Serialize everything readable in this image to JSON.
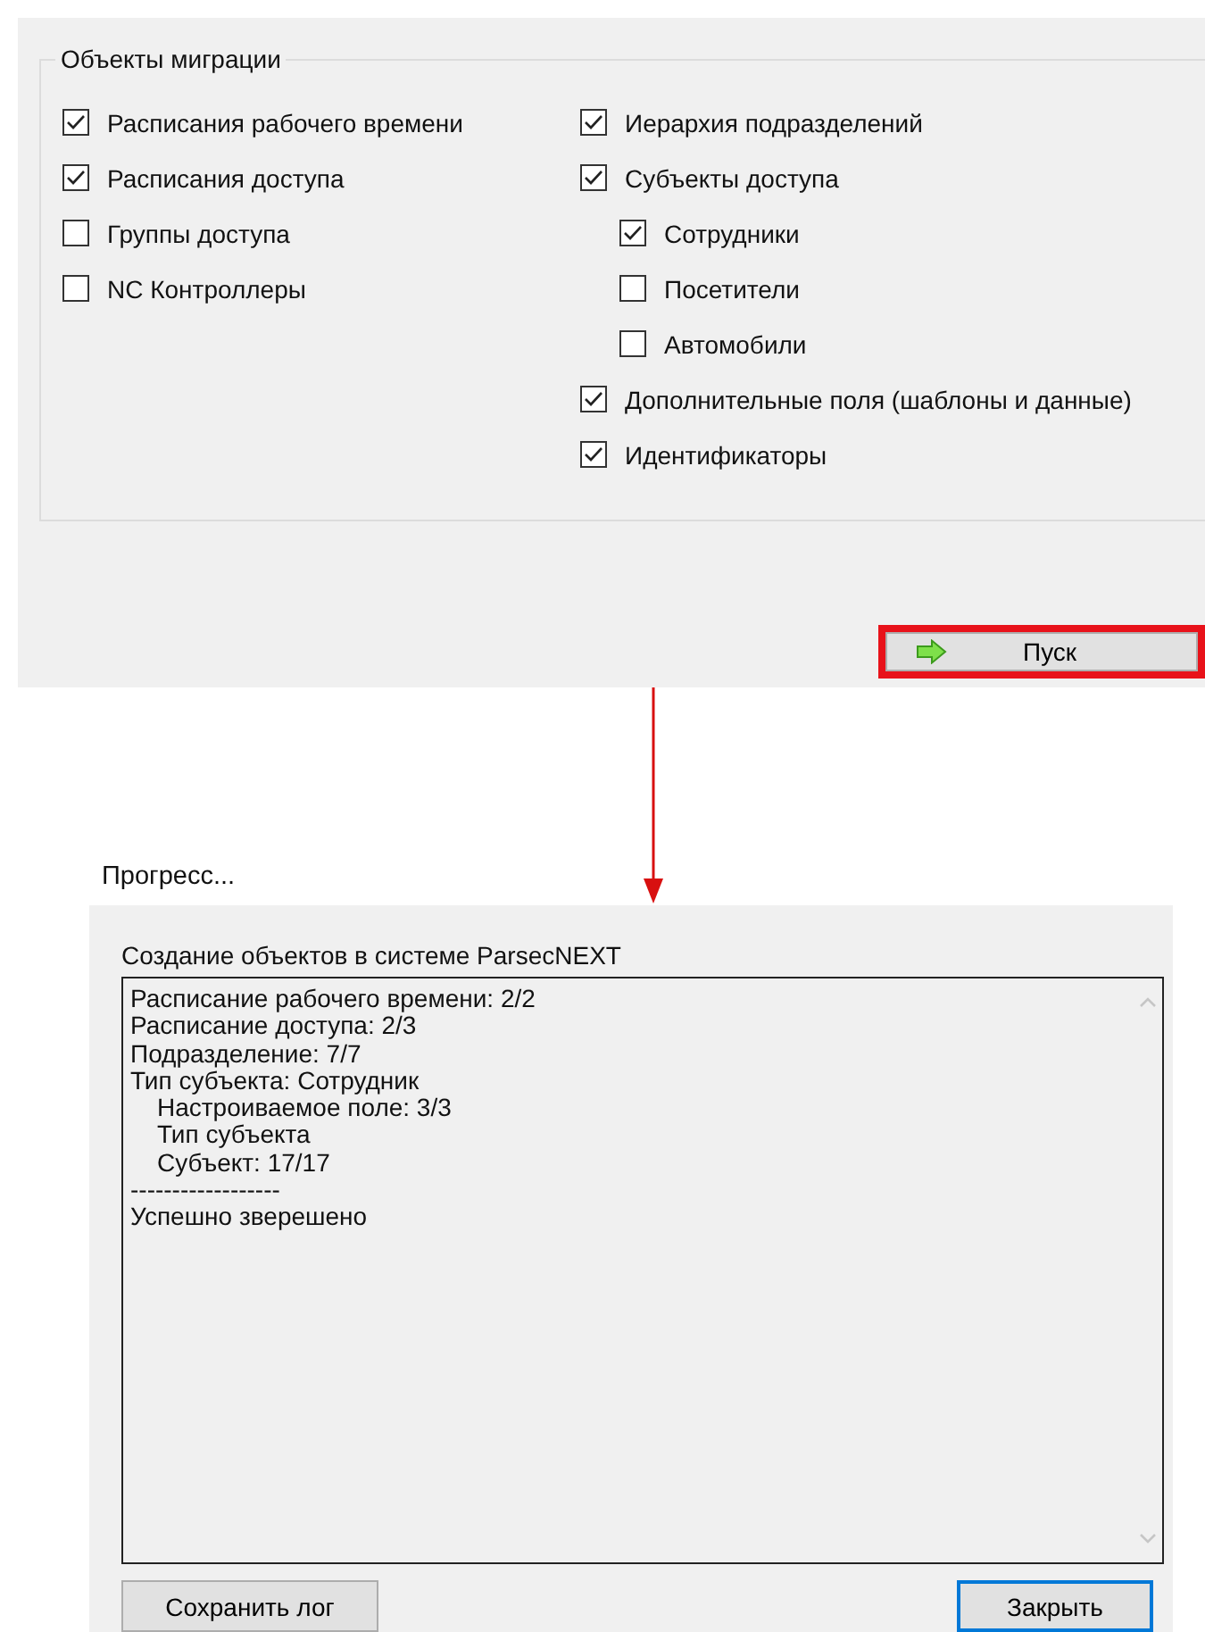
{
  "migration": {
    "title": "Объекты миграции",
    "left": [
      {
        "label": "Расписания рабочего времени",
        "checked": true
      },
      {
        "label": "Расписания доступа",
        "checked": true
      },
      {
        "label": "Группы доступа",
        "checked": false
      },
      {
        "label": "NC Контроллеры",
        "checked": false
      }
    ],
    "right": [
      {
        "label": "Иерархия подразделений",
        "checked": true
      },
      {
        "label": "Субъекты доступа",
        "checked": true,
        "children": [
          {
            "label": "Сотрудники",
            "checked": true
          },
          {
            "label": "Посетители",
            "checked": false
          },
          {
            "label": "Автомобили",
            "checked": false
          }
        ]
      },
      {
        "label": "Дополнительные поля (шаблоны и данные)",
        "checked": true
      },
      {
        "label": "Идентификаторы",
        "checked": true
      }
    ],
    "start_button": {
      "label": "Пуск",
      "highlighted": true
    }
  },
  "progress": {
    "title": "Прогресс...",
    "caption": "Создание объектов в системе ParsecNEXT",
    "log": [
      {
        "text": "Расписание рабочего времени: 2/2"
      },
      {
        "text": "Расписание доступа: 2/3"
      },
      {
        "text": "Подразделение: 7/7"
      },
      {
        "text": "Тип субъекта: Сотрудник",
        "children": [
          {
            "text": "Настроиваемое поле: 3/3"
          },
          {
            "text": "Тип субъекта"
          },
          {
            "text": "Субъект: 17/17"
          }
        ]
      },
      {
        "text": "------------------"
      },
      {
        "text": "Успешно зверешено"
      }
    ],
    "buttons": [
      {
        "label": "Сохранить лог",
        "default": false
      },
      {
        "label": "Закрыть",
        "default": true
      }
    ]
  }
}
